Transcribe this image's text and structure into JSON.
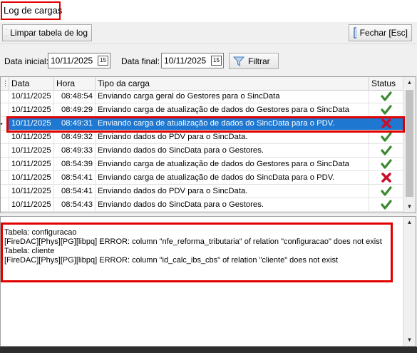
{
  "window": {
    "title": "Log de cargas"
  },
  "toolbar": {
    "clear_label": "Limpar tabela de log",
    "close_label": "Fechar [Esc]"
  },
  "filters": {
    "start_label": "Data inicial:",
    "start_value": "10/11/2025",
    "end_label": "Data final:",
    "end_value": "10/11/2025",
    "calendar_glyph": "15",
    "filter_label": "Filtrar"
  },
  "grid": {
    "columns": [
      "Data",
      "Hora",
      "Tipo da carga",
      "Status"
    ],
    "rows": [
      {
        "date": "10/11/2025",
        "time": "08:48:54",
        "type": "Enviando carga geral do Gestores para o SincData",
        "status": "success"
      },
      {
        "date": "10/11/2025",
        "time": "08:49:29",
        "type": "Enviando carga de atualização de dados do Gestores para o SincData",
        "status": "success"
      },
      {
        "date": "10/11/2025",
        "time": "08:49:31",
        "type": "Enviando carga de atualização de dados do SincData para o PDV.",
        "status": "error",
        "selected": true
      },
      {
        "date": "10/11/2025",
        "time": "08:49:32",
        "type": "Enviando dados do PDV para o SincData.",
        "status": "success"
      },
      {
        "date": "10/11/2025",
        "time": "08:49:33",
        "type": "Enviando dados do SincData para o Gestores.",
        "status": "success"
      },
      {
        "date": "10/11/2025",
        "time": "08:54:39",
        "type": "Enviando carga de atualização de dados do Gestores para o SincData",
        "status": "success"
      },
      {
        "date": "10/11/2025",
        "time": "08:54:41",
        "type": "Enviando carga de atualização de dados do SincData para o PDV.",
        "status": "error"
      },
      {
        "date": "10/11/2025",
        "time": "08:54:41",
        "type": "Enviando dados do PDV para o SincData.",
        "status": "success"
      },
      {
        "date": "10/11/2025",
        "time": "08:54:43",
        "type": "Enviando dados do SincData para o Gestores.",
        "status": "success"
      }
    ]
  },
  "detail": {
    "lines": [
      "Tabela: configuracao",
      "[FireDAC][Phys][PG][libpq] ERROR: column \"nfe_reforma_tributaria\" of relation \"configuracao\" does not exist",
      "Tabela: cliente",
      "[FireDAC][Phys][PG][libpq] ERROR: column \"id_calc_ibs_cbs\" of relation \"cliente\" does not exist"
    ]
  },
  "colors": {
    "selection": "#1e78d2",
    "highlight_outline": "#e10000",
    "success": "#3a8a2e",
    "error": "#c8102e"
  },
  "icons": {
    "clear": "clear-x-icon",
    "close": "door-icon",
    "filter": "funnel-icon",
    "calendar": "calendar-icon",
    "success": "check-icon",
    "error": "x-icon",
    "row_indicator": "row-pointer-icon"
  }
}
